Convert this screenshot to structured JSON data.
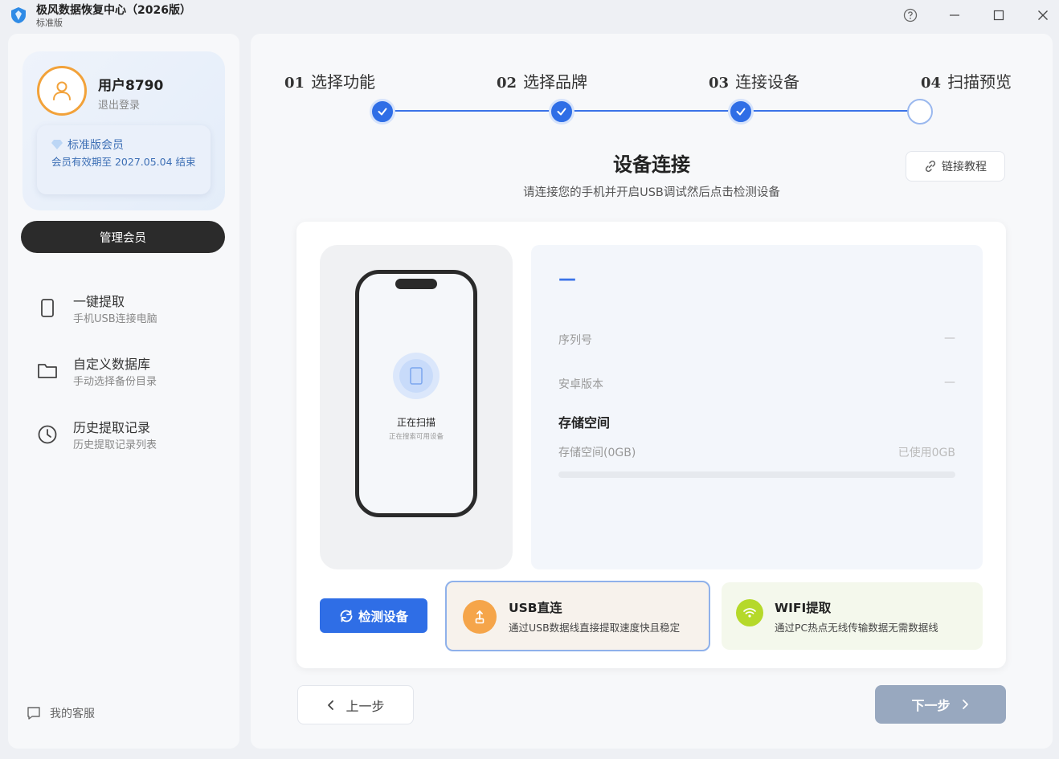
{
  "app": {
    "title": "极风数据恢复中心（2026版）",
    "edition": "标准版"
  },
  "user": {
    "name": "用户8790",
    "logout_label": "退出登录",
    "member_title": "标准版会员",
    "member_expire": "会员有效期至 2027.05.04 结束",
    "manage_label": "管理会员"
  },
  "sidebar": {
    "items": [
      {
        "title": "一键提取",
        "subtitle": "手机USB连接电脑",
        "icon": "phone-icon"
      },
      {
        "title": "自定义数据库",
        "subtitle": "手动选择备份目录",
        "icon": "folder-icon"
      },
      {
        "title": "历史提取记录",
        "subtitle": "历史提取记录列表",
        "icon": "clock-icon"
      }
    ],
    "service_label": "我的客服"
  },
  "steps": [
    {
      "num": "01",
      "label": "选择功能",
      "done": true
    },
    {
      "num": "02",
      "label": "选择品牌",
      "done": true
    },
    {
      "num": "03",
      "label": "连接设备",
      "done": true
    },
    {
      "num": "04",
      "label": "扫描预览",
      "done": false
    }
  ],
  "main": {
    "title": "设备连接",
    "subtitle": "请连接您的手机并开启USB调试然后点击检测设备",
    "tutorial_label": "链接教程"
  },
  "phone": {
    "scan_title": "正在扫描",
    "scan_sub": "正在搜索可用设备"
  },
  "device_info": {
    "name": "—",
    "serial_label": "序列号",
    "serial_value": "—",
    "android_label": "安卓版本",
    "android_value": "—",
    "storage_title": "存储空间",
    "storage_label": "存储空间(0GB)",
    "storage_used": "已使用0GB",
    "storage_used_fraction": 0
  },
  "actions": {
    "detect_label": "检测设备",
    "usb_title": "USB直连",
    "usb_sub": "通过USB数据线直接提取速度快且稳定",
    "wifi_title": "WIFI提取",
    "wifi_sub": "通过PC热点无线传输数据无需数据线",
    "prev_label": "上一步",
    "next_label": "下一步"
  },
  "colors": {
    "accent": "#2f6ee6",
    "avatar_ring": "#f2a23a",
    "usb_icon": "#f5a54a",
    "wifi_icon": "#b5d92a",
    "next_disabled": "#98a8bf"
  }
}
